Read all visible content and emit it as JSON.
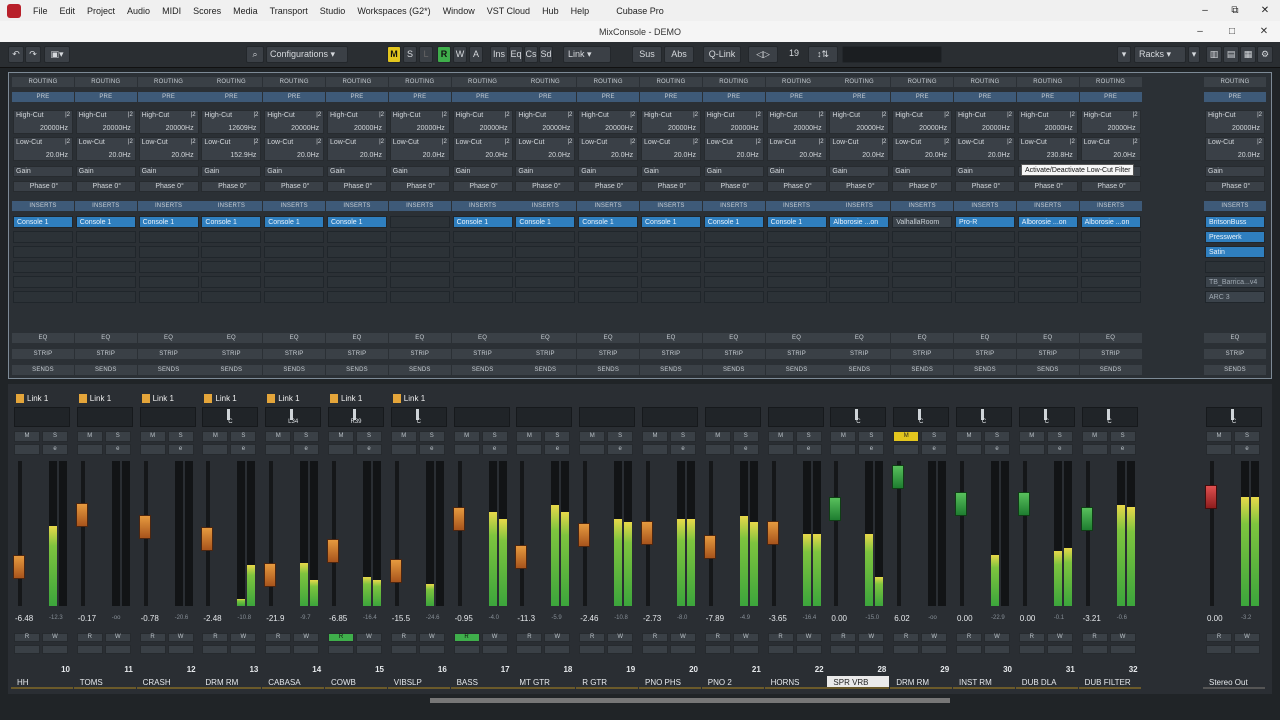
{
  "app": {
    "menu": [
      "File",
      "Edit",
      "Project",
      "Audio",
      "MIDI",
      "Scores",
      "Media",
      "Transport",
      "Studio",
      "Workspaces (G2*)",
      "Window",
      "VST Cloud",
      "Hub",
      "Help"
    ],
    "title": "Cubase Pro",
    "window_title": "MixConsole - DEMO"
  },
  "toolbar": {
    "configurations": "Configurations",
    "m": "M",
    "s": "S",
    "l": "L",
    "r": "R",
    "w": "W",
    "a": "A",
    "ins": "Ins",
    "eq": "Eq",
    "cs": "Cs",
    "sd": "Sd",
    "link": "Link",
    "sus": "Sus",
    "abs": "Abs",
    "qlink": "Q-Link",
    "channels": "19",
    "racks": "Racks"
  },
  "labels": {
    "routing": "ROUTING",
    "pre": "PRE",
    "inserts": "INSERTS",
    "eq": "EQ",
    "strip": "STRIP",
    "sends": "SENDS",
    "highcut": "High-Cut",
    "lowcut": "Low-Cut",
    "gain": "Gain",
    "phase": "Phase 0°",
    "m": "M",
    "s": "S",
    "e": "e",
    "r": "R",
    "w": "W"
  },
  "tooltip": "Activate/Deactivate Low-Cut Filter",
  "channels": [
    {
      "name": "HH",
      "num": "10",
      "hc": "20000Hz",
      "lc": "20.0Hz",
      "inserts": [
        "Console 1"
      ],
      "link": "Link 1",
      "pan": "",
      "vol": "-6.48",
      "vol2": "-12.3"
    },
    {
      "name": "TOMS",
      "num": "11",
      "hc": "20000Hz",
      "lc": "20.0Hz",
      "inserts": [
        "Console 1"
      ],
      "link": "Link 1",
      "pan": "",
      "vol": "-0.17",
      "vol2": "-oo"
    },
    {
      "name": "CRASH",
      "num": "12",
      "hc": "20000Hz",
      "lc": "20.0Hz",
      "inserts": [
        "Console 1"
      ],
      "link": "Link 1",
      "pan": "",
      "vol": "-0.78",
      "vol2": "-20.6"
    },
    {
      "name": "DRM RM",
      "num": "13",
      "hc": "12609Hz",
      "lc": "152.9Hz",
      "inserts": [
        "Console 1"
      ],
      "link": "Link 1",
      "pan": "C",
      "vol": "-2.48",
      "vol2": "-10.8"
    },
    {
      "name": "CABASA",
      "num": "14",
      "hc": "20000Hz",
      "lc": "20.0Hz",
      "inserts": [
        "Console 1"
      ],
      "link": "Link 1",
      "pan": "L34",
      "vol": "-21.9",
      "vol2": "-9.7"
    },
    {
      "name": "COWB",
      "num": "15",
      "hc": "20000Hz",
      "lc": "20.0Hz",
      "inserts": [
        "Console 1"
      ],
      "link": "Link 1",
      "pan": "R39",
      "vol": "-6.85",
      "vol2": "-16.4"
    },
    {
      "name": "VIBSLP",
      "num": "16",
      "hc": "20000Hz",
      "lc": "20.0Hz",
      "inserts": [],
      "link": "Link 1",
      "pan": "C",
      "vol": "-15.5",
      "vol2": "-24.6"
    },
    {
      "name": "BASS",
      "num": "17",
      "hc": "20000Hz",
      "lc": "20.0Hz",
      "inserts": [
        "Console 1"
      ],
      "link": "",
      "pan": "",
      "vol": "-0.95",
      "vol2": "-4.0"
    },
    {
      "name": "MT GTR",
      "num": "18",
      "hc": "20000Hz",
      "lc": "20.0Hz",
      "inserts": [
        "Console 1"
      ],
      "link": "",
      "pan": "",
      "vol": "-11.3",
      "vol2": "-5.9"
    },
    {
      "name": "R GTR",
      "num": "19",
      "hc": "20000Hz",
      "lc": "20.0Hz",
      "inserts": [
        "Console 1"
      ],
      "link": "",
      "pan": "",
      "vol": "-2.46",
      "vol2": "-10.8"
    },
    {
      "name": "PNO PHS",
      "num": "20",
      "hc": "20000Hz",
      "lc": "20.0Hz",
      "inserts": [
        "Console 1"
      ],
      "link": "",
      "pan": "",
      "vol": "-2.73",
      "vol2": "-8.0"
    },
    {
      "name": "PNO 2",
      "num": "21",
      "hc": "20000Hz",
      "lc": "20.0Hz",
      "inserts": [
        "Console 1"
      ],
      "link": "",
      "pan": "",
      "vol": "-7.89",
      "vol2": "-4.9"
    },
    {
      "name": "HORNS",
      "num": "22",
      "hc": "20000Hz",
      "lc": "20.0Hz",
      "inserts": [
        "Console 1"
      ],
      "link": "",
      "pan": "",
      "vol": "-3.65",
      "vol2": "-16.4"
    },
    {
      "name": "SPR VRB",
      "num": "28",
      "hc": "20000Hz",
      "lc": "20.0Hz",
      "inserts": [
        "Alborosie ...on"
      ],
      "link": "",
      "pan": "C",
      "vol": "0.00",
      "vol2": "-15.0"
    },
    {
      "name": "DRM RM",
      "num": "29",
      "hc": "20000Hz",
      "lc": "20.0Hz",
      "inserts": [
        "ValhallaRoom"
      ],
      "link": "",
      "pan": "C",
      "vol": "6.02",
      "vol2": "-oo"
    },
    {
      "name": "INST RM",
      "num": "30",
      "hc": "20000Hz",
      "lc": "20.0Hz",
      "inserts": [
        "Pro-R"
      ],
      "link": "",
      "pan": "C",
      "vol": "0.00",
      "vol2": "-22.9"
    },
    {
      "name": "DUB DLA",
      "num": "31",
      "hc": "20000Hz",
      "lc": "230.8Hz",
      "inserts": [
        "Alborosie ...on"
      ],
      "link": "",
      "pan": "C",
      "vol": "0.00",
      "vol2": "-0.1"
    },
    {
      "name": "DUB FILTER",
      "num": "32",
      "hc": "20000Hz",
      "lc": "20.0Hz",
      "inserts": [
        "Alborosie ...on"
      ],
      "link": "",
      "pan": "C",
      "vol": "-3.21",
      "vol2": "-0.6"
    }
  ],
  "stereo_out": {
    "name": "Stereo Out",
    "hc": "20000Hz",
    "lc": "20.0Hz",
    "inserts": [
      "BritsonBuss",
      "Presswerk",
      "Satin",
      "",
      "TB_Barrica...v4",
      "ARC 3"
    ],
    "pan": "C",
    "vol": "0.00",
    "vol2": "-3.2"
  }
}
